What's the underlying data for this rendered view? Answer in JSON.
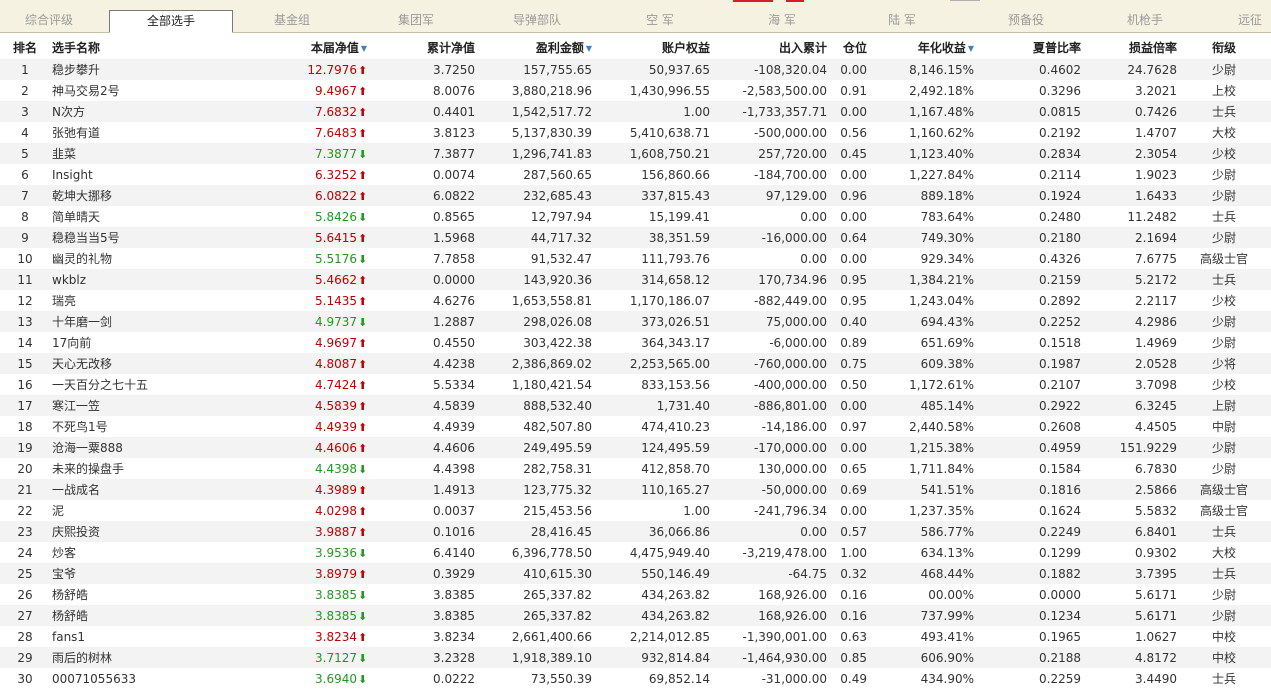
{
  "tabs": [
    {
      "label": "综合评级",
      "active": false
    },
    {
      "label": "全部选手",
      "active": true
    },
    {
      "label": "基金组",
      "active": false
    },
    {
      "label": "集团军",
      "active": false
    },
    {
      "label": "导弹部队",
      "active": false
    },
    {
      "label": "空 军",
      "active": false
    },
    {
      "label": "海 军",
      "active": false
    },
    {
      "label": "陆 军",
      "active": false
    },
    {
      "label": "预备役",
      "active": false
    },
    {
      "label": "机枪手",
      "active": false
    },
    {
      "label": "远征",
      "active": false
    }
  ],
  "colors": {
    "up": "#c00000",
    "down": "#1e9a1e",
    "sort_arrow": "#3a7fd0",
    "tab_bar": "#f6f2e2",
    "row_alt": "#f3f3f3",
    "top_marker_red": "#d42020",
    "top_marker_gray": "#b0b0b0"
  },
  "headers": {
    "rank": "排名",
    "name": "选手名称",
    "nav": "本届净值",
    "cum_nav": "累计净值",
    "profit": "盈利金额",
    "equity": "账户权益",
    "inout": "出入累计",
    "position": "仓位",
    "annual": "年化收益",
    "sharpe": "夏普比率",
    "pl_ratio": "损益倍率",
    "rank_title": "衔级"
  },
  "sort_icon": "triangle-down-icon",
  "rows": [
    {
      "rank": "1",
      "name": "稳步攀升",
      "nav": "12.7976",
      "trend": "up",
      "cum_nav": "3.7250",
      "profit": "157,755.65",
      "equity": "50,937.65",
      "inout": "-108,320.04",
      "position": "0.00",
      "annual": "8,146.15%",
      "sharpe": "0.4602",
      "pl_ratio": "24.7628",
      "title": "少尉"
    },
    {
      "rank": "2",
      "name": "神马交易2号",
      "nav": "9.4967",
      "trend": "up",
      "cum_nav": "8.0076",
      "profit": "3,880,218.96",
      "equity": "1,430,996.55",
      "inout": "-2,583,500.00",
      "position": "0.91",
      "annual": "2,492.18%",
      "sharpe": "0.3296",
      "pl_ratio": "3.2021",
      "title": "上校"
    },
    {
      "rank": "3",
      "name": "N次方",
      "nav": "7.6832",
      "trend": "up",
      "cum_nav": "0.4401",
      "profit": "1,542,517.72",
      "equity": "1.00",
      "inout": "-1,733,357.71",
      "position": "0.00",
      "annual": "1,167.48%",
      "sharpe": "0.0815",
      "pl_ratio": "0.7426",
      "title": "士兵"
    },
    {
      "rank": "4",
      "name": "张弛有道",
      "nav": "7.6483",
      "trend": "up",
      "cum_nav": "3.8123",
      "profit": "5,137,830.39",
      "equity": "5,410,638.71",
      "inout": "-500,000.00",
      "position": "0.56",
      "annual": "1,160.62%",
      "sharpe": "0.2192",
      "pl_ratio": "1.4707",
      "title": "大校"
    },
    {
      "rank": "5",
      "name": "韭菜",
      "nav": "7.3877",
      "trend": "down",
      "cum_nav": "7.3877",
      "profit": "1,296,741.83",
      "equity": "1,608,750.21",
      "inout": "257,720.00",
      "position": "0.45",
      "annual": "1,123.40%",
      "sharpe": "0.2834",
      "pl_ratio": "2.3054",
      "title": "少校"
    },
    {
      "rank": "6",
      "name": "Insight",
      "nav": "6.3252",
      "trend": "up",
      "cum_nav": "0.0074",
      "profit": "287,560.65",
      "equity": "156,860.66",
      "inout": "-184,700.00",
      "position": "0.00",
      "annual": "1,227.84%",
      "sharpe": "0.2114",
      "pl_ratio": "1.9023",
      "title": "少尉"
    },
    {
      "rank": "7",
      "name": "乾坤大挪移",
      "nav": "6.0822",
      "trend": "up",
      "cum_nav": "6.0822",
      "profit": "232,685.43",
      "equity": "337,815.43",
      "inout": "97,129.00",
      "position": "0.96",
      "annual": "889.18%",
      "sharpe": "0.1924",
      "pl_ratio": "1.6433",
      "title": "少尉"
    },
    {
      "rank": "8",
      "name": "简单晴天",
      "nav": "5.8426",
      "trend": "down",
      "cum_nav": "0.8565",
      "profit": "12,797.94",
      "equity": "15,199.41",
      "inout": "0.00",
      "position": "0.00",
      "annual": "783.64%",
      "sharpe": "0.2480",
      "pl_ratio": "11.2482",
      "title": "士兵"
    },
    {
      "rank": "9",
      "name": "稳稳当当5号",
      "nav": "5.6415",
      "trend": "up",
      "cum_nav": "1.5968",
      "profit": "44,717.32",
      "equity": "38,351.59",
      "inout": "-16,000.00",
      "position": "0.64",
      "annual": "749.30%",
      "sharpe": "0.2180",
      "pl_ratio": "2.1694",
      "title": "少尉"
    },
    {
      "rank": "10",
      "name": "幽灵的礼物",
      "nav": "5.5176",
      "trend": "down",
      "cum_nav": "7.7858",
      "profit": "91,532.47",
      "equity": "111,793.76",
      "inout": "0.00",
      "position": "0.00",
      "annual": "929.34%",
      "sharpe": "0.4326",
      "pl_ratio": "7.6775",
      "title": "高级士官"
    },
    {
      "rank": "11",
      "name": "wkblz",
      "nav": "5.4662",
      "trend": "up",
      "cum_nav": "0.0000",
      "profit": "143,920.36",
      "equity": "314,658.12",
      "inout": "170,734.96",
      "position": "0.95",
      "annual": "1,384.21%",
      "sharpe": "0.2159",
      "pl_ratio": "5.2172",
      "title": "士兵"
    },
    {
      "rank": "12",
      "name": "瑞亮",
      "nav": "5.1435",
      "trend": "up",
      "cum_nav": "4.6276",
      "profit": "1,653,558.81",
      "equity": "1,170,186.07",
      "inout": "-882,449.00",
      "position": "0.95",
      "annual": "1,243.04%",
      "sharpe": "0.2892",
      "pl_ratio": "2.2117",
      "title": "少校"
    },
    {
      "rank": "13",
      "name": "十年磨一剑",
      "nav": "4.9737",
      "trend": "down",
      "cum_nav": "1.2887",
      "profit": "298,026.08",
      "equity": "373,026.51",
      "inout": "75,000.00",
      "position": "0.40",
      "annual": "694.43%",
      "sharpe": "0.2252",
      "pl_ratio": "4.2986",
      "title": "少尉"
    },
    {
      "rank": "14",
      "name": "17向前",
      "nav": "4.9697",
      "trend": "up",
      "cum_nav": "0.4550",
      "profit": "303,422.38",
      "equity": "364,343.17",
      "inout": "-6,000.00",
      "position": "0.89",
      "annual": "651.69%",
      "sharpe": "0.1518",
      "pl_ratio": "1.4969",
      "title": "少尉"
    },
    {
      "rank": "15",
      "name": "天心无改移",
      "nav": "4.8087",
      "trend": "up",
      "cum_nav": "4.4238",
      "profit": "2,386,869.02",
      "equity": "2,253,565.00",
      "inout": "-760,000.00",
      "position": "0.75",
      "annual": "609.38%",
      "sharpe": "0.1987",
      "pl_ratio": "2.0528",
      "title": "少将"
    },
    {
      "rank": "16",
      "name": "一天百分之七十五",
      "nav": "4.7424",
      "trend": "up",
      "cum_nav": "5.5334",
      "profit": "1,180,421.54",
      "equity": "833,153.56",
      "inout": "-400,000.00",
      "position": "0.50",
      "annual": "1,172.61%",
      "sharpe": "0.2107",
      "pl_ratio": "3.7098",
      "title": "少校"
    },
    {
      "rank": "17",
      "name": "寒江一笠",
      "nav": "4.5839",
      "trend": "up",
      "cum_nav": "4.5839",
      "profit": "888,532.40",
      "equity": "1,731.40",
      "inout": "-886,801.00",
      "position": "0.00",
      "annual": "485.14%",
      "sharpe": "0.2922",
      "pl_ratio": "6.3245",
      "title": "上尉"
    },
    {
      "rank": "18",
      "name": "不死鸟1号",
      "nav": "4.4939",
      "trend": "up",
      "cum_nav": "4.4939",
      "profit": "482,507.80",
      "equity": "474,410.23",
      "inout": "-14,186.00",
      "position": "0.97",
      "annual": "2,440.58%",
      "sharpe": "0.2608",
      "pl_ratio": "4.4505",
      "title": "中尉"
    },
    {
      "rank": "19",
      "name": "沧海一粟888",
      "nav": "4.4606",
      "trend": "up",
      "cum_nav": "4.4606",
      "profit": "249,495.59",
      "equity": "124,495.59",
      "inout": "-170,000.00",
      "position": "0.00",
      "annual": "1,215.38%",
      "sharpe": "0.4959",
      "pl_ratio": "151.9229",
      "title": "少尉"
    },
    {
      "rank": "20",
      "name": "未来的操盘手",
      "nav": "4.4398",
      "trend": "down",
      "cum_nav": "4.4398",
      "profit": "282,758.31",
      "equity": "412,858.70",
      "inout": "130,000.00",
      "position": "0.65",
      "annual": "1,711.84%",
      "sharpe": "0.1584",
      "pl_ratio": "6.7830",
      "title": "少尉"
    },
    {
      "rank": "21",
      "name": "一战成名",
      "nav": "4.3989",
      "trend": "up",
      "cum_nav": "1.4913",
      "profit": "123,775.32",
      "equity": "110,165.27",
      "inout": "-50,000.00",
      "position": "0.69",
      "annual": "541.51%",
      "sharpe": "0.1816",
      "pl_ratio": "2.5866",
      "title": "高级士官"
    },
    {
      "rank": "22",
      "name": "泥",
      "nav": "4.0298",
      "trend": "up",
      "cum_nav": "0.0037",
      "profit": "215,453.56",
      "equity": "1.00",
      "inout": "-241,796.34",
      "position": "0.00",
      "annual": "1,237.35%",
      "sharpe": "0.1624",
      "pl_ratio": "5.5832",
      "title": "高级士官"
    },
    {
      "rank": "23",
      "name": "庆熙投资",
      "nav": "3.9887",
      "trend": "up",
      "cum_nav": "0.1016",
      "profit": "28,416.45",
      "equity": "36,066.86",
      "inout": "0.00",
      "position": "0.57",
      "annual": "586.77%",
      "sharpe": "0.2249",
      "pl_ratio": "6.8401",
      "title": "士兵"
    },
    {
      "rank": "24",
      "name": "炒客",
      "nav": "3.9536",
      "trend": "down",
      "cum_nav": "6.4140",
      "profit": "6,396,778.50",
      "equity": "4,475,949.40",
      "inout": "-3,219,478.00",
      "position": "1.00",
      "annual": "634.13%",
      "sharpe": "0.1299",
      "pl_ratio": "0.9302",
      "title": "大校"
    },
    {
      "rank": "25",
      "name": "宝爷",
      "nav": "3.8979",
      "trend": "up",
      "cum_nav": "0.3929",
      "profit": "410,615.30",
      "equity": "550,146.49",
      "inout": "-64.75",
      "position": "0.32",
      "annual": "468.44%",
      "sharpe": "0.1882",
      "pl_ratio": "3.7395",
      "title": "士兵"
    },
    {
      "rank": "26",
      "name": "杨舒皓",
      "nav": "3.8385",
      "trend": "down",
      "cum_nav": "3.8385",
      "profit": "265,337.82",
      "equity": "434,263.82",
      "inout": "168,926.00",
      "position": "0.16",
      "annual": "00.00%",
      "sharpe": "0.0000",
      "pl_ratio": "5.6171",
      "title": "少尉"
    },
    {
      "rank": "27",
      "name": "杨舒皓",
      "nav": "3.8385",
      "trend": "down",
      "cum_nav": "3.8385",
      "profit": "265,337.82",
      "equity": "434,263.82",
      "inout": "168,926.00",
      "position": "0.16",
      "annual": "737.99%",
      "sharpe": "0.1234",
      "pl_ratio": "5.6171",
      "title": "少尉"
    },
    {
      "rank": "28",
      "name": "fans1",
      "nav": "3.8234",
      "trend": "up",
      "cum_nav": "3.8234",
      "profit": "2,661,400.66",
      "equity": "2,214,012.85",
      "inout": "-1,390,001.00",
      "position": "0.63",
      "annual": "493.41%",
      "sharpe": "0.1965",
      "pl_ratio": "1.0627",
      "title": "中校"
    },
    {
      "rank": "29",
      "name": "雨后的树林",
      "nav": "3.7127",
      "trend": "down",
      "cum_nav": "3.2328",
      "profit": "1,918,389.10",
      "equity": "932,814.84",
      "inout": "-1,464,930.00",
      "position": "0.85",
      "annual": "606.90%",
      "sharpe": "0.2188",
      "pl_ratio": "4.8172",
      "title": "中校"
    },
    {
      "rank": "30",
      "name": "00071055633",
      "nav": "3.6940",
      "trend": "down",
      "cum_nav": "0.0222",
      "profit": "73,550.39",
      "equity": "69,852.14",
      "inout": "-31,000.00",
      "position": "0.49",
      "annual": "434.90%",
      "sharpe": "0.2259",
      "pl_ratio": "3.4490",
      "title": "士兵"
    }
  ]
}
